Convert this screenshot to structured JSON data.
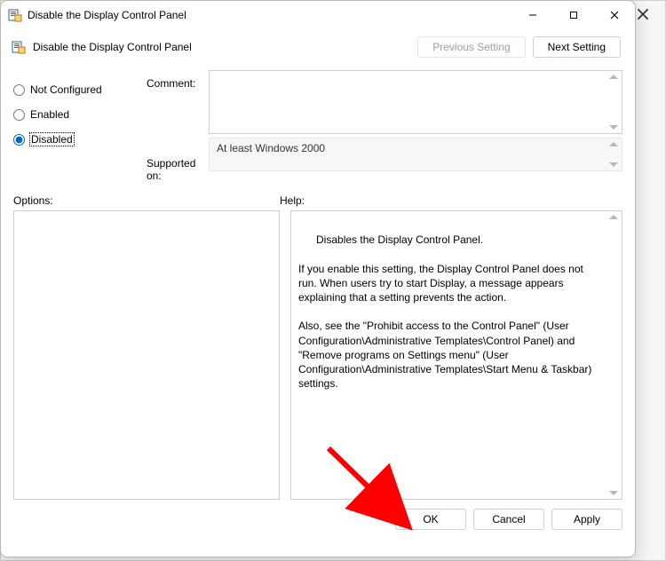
{
  "background": {
    "close_icon": "close"
  },
  "dialog": {
    "title": "Disable the Display Control Panel",
    "subtitle": "Disable the Display Control Panel",
    "previous_label": "Previous Setting",
    "next_label": "Next Setting",
    "not_configured_label": "Not Configured",
    "enabled_label": "Enabled",
    "disabled_label": "Disabled",
    "selected_option": "disabled",
    "comment_label": "Comment:",
    "comment_value": "",
    "supported_label": "Supported on:",
    "supported_value": "At least Windows 2000",
    "options_label": "Options:",
    "help_label": "Help:",
    "help_text": "Disables the Display Control Panel.\n\nIf you enable this setting, the Display Control Panel does not run. When users try to start Display, a message appears explaining that a setting prevents the action.\n\nAlso, see the \"Prohibit access to the Control Panel\" (User Configuration\\Administrative Templates\\Control Panel) and \"Remove programs on Settings menu\" (User Configuration\\Administrative Templates\\Start Menu & Taskbar) settings.",
    "ok_label": "OK",
    "cancel_label": "Cancel",
    "apply_label": "Apply"
  },
  "annotation": {
    "arrow_target": "ok-button"
  }
}
